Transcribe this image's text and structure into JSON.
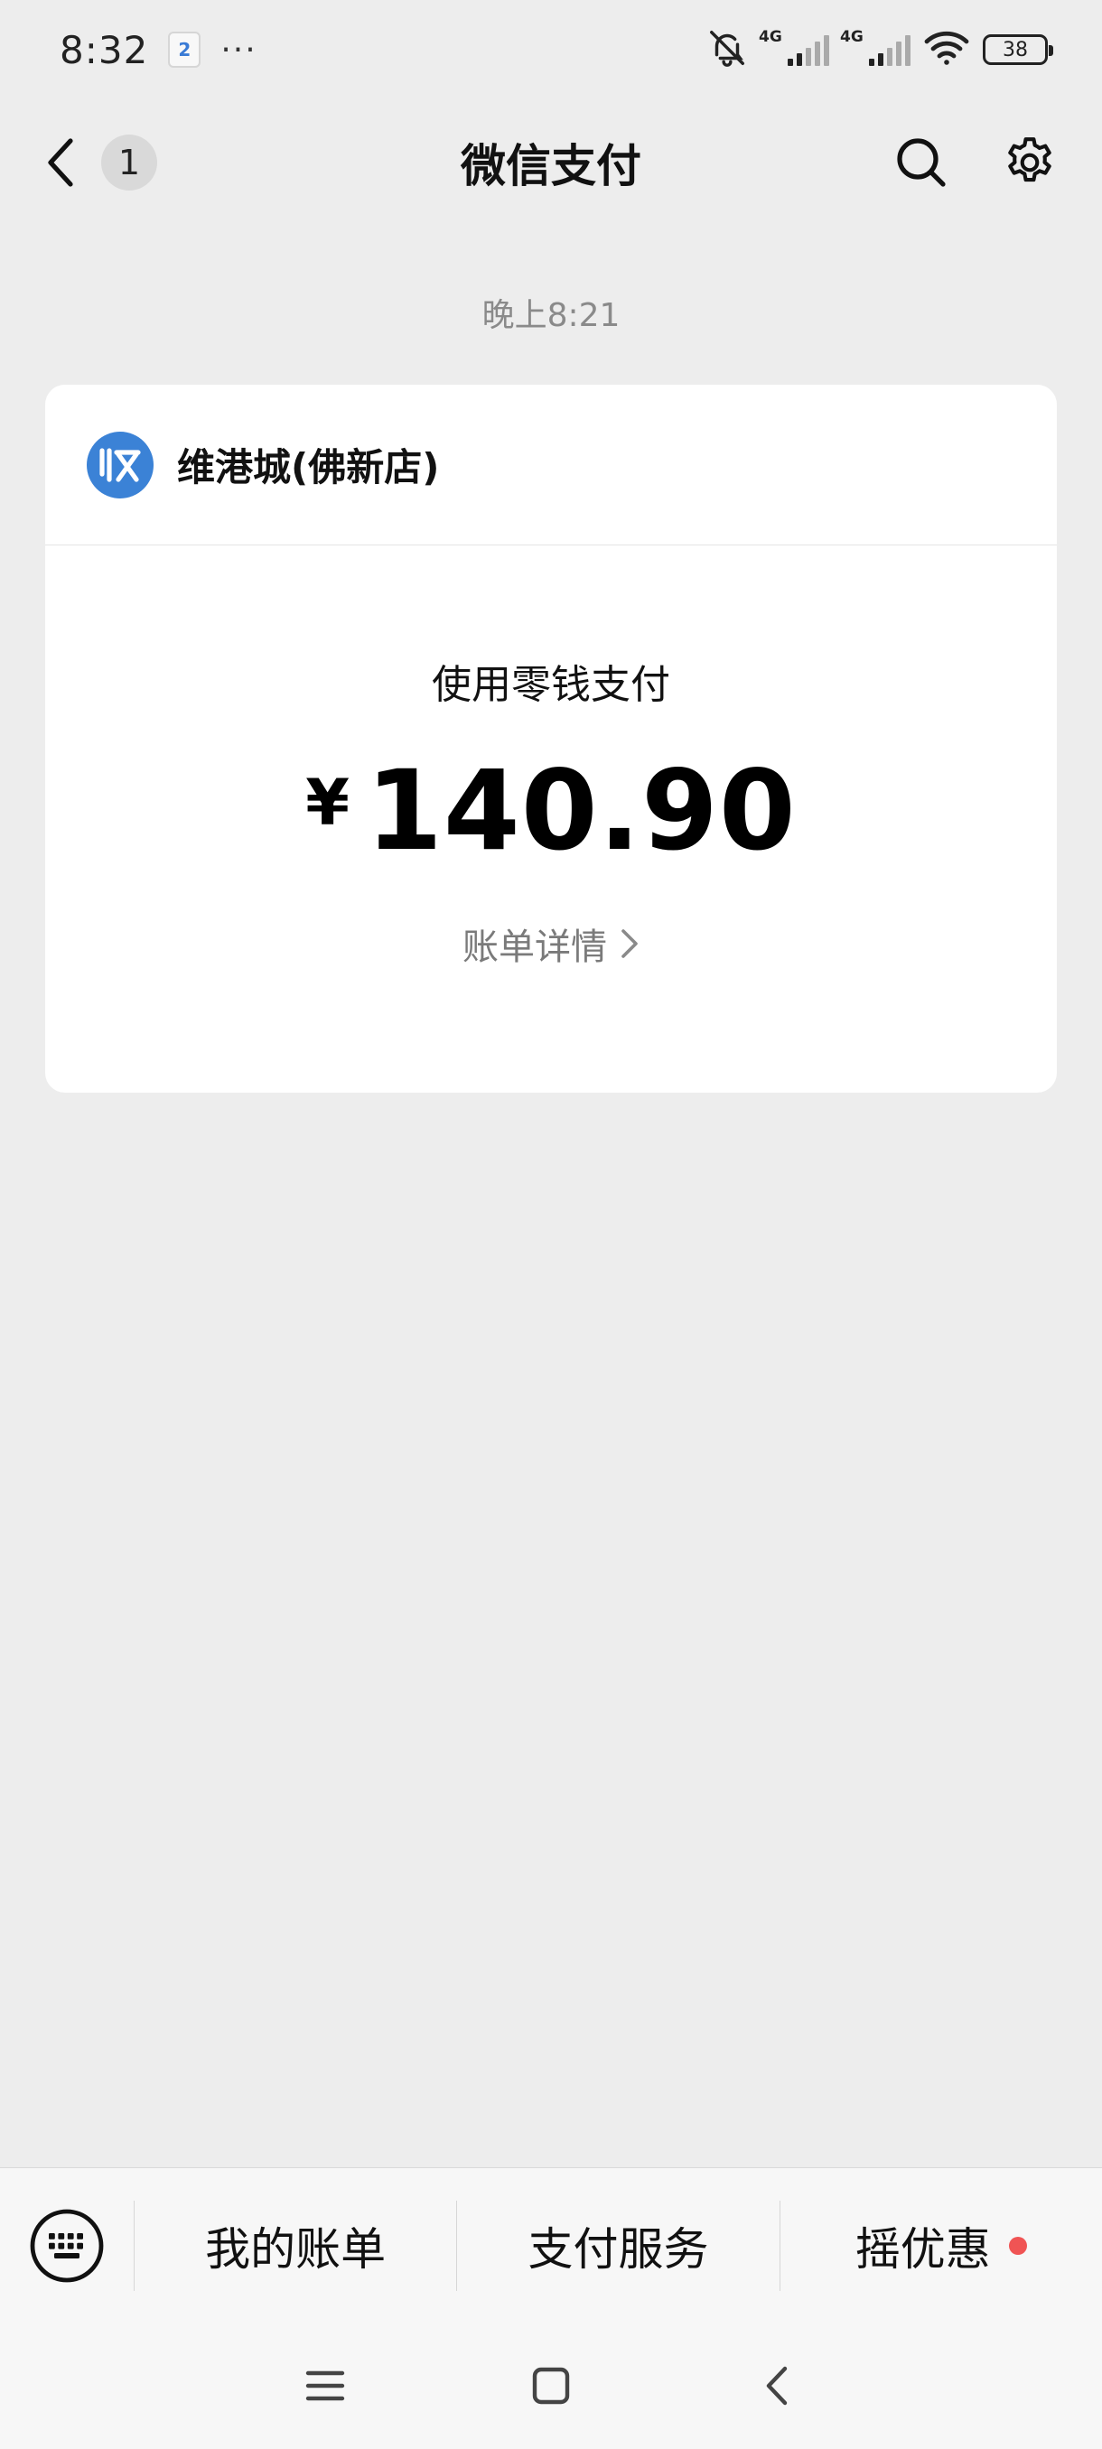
{
  "status_bar": {
    "time": "8:32",
    "notification_label": "2",
    "more": "···",
    "network_1": "4G",
    "network_2": "4G",
    "battery": "38"
  },
  "nav": {
    "back_count": "1",
    "title": "微信支付"
  },
  "message": {
    "timestamp": "晚上8:21",
    "merchant_name": "维港城(佛新店)",
    "pay_method": "使用零钱支付",
    "currency": "¥",
    "amount": "140.90",
    "detail_link": "账单详情"
  },
  "bottom_menu": {
    "items": [
      {
        "label": "我的账单"
      },
      {
        "label": "支付服务"
      },
      {
        "label": "摇优惠",
        "has_dot": true
      }
    ]
  },
  "colors": {
    "background": "#ededed",
    "card": "#ffffff",
    "merchant_logo": "#3b82d6",
    "red_dot": "#f05454"
  },
  "icons": {
    "back": "chevron-left-icon",
    "search": "search-icon",
    "settings": "gear-icon",
    "keyboard": "keyboard-icon",
    "merchant": "receive-payment-icon"
  }
}
